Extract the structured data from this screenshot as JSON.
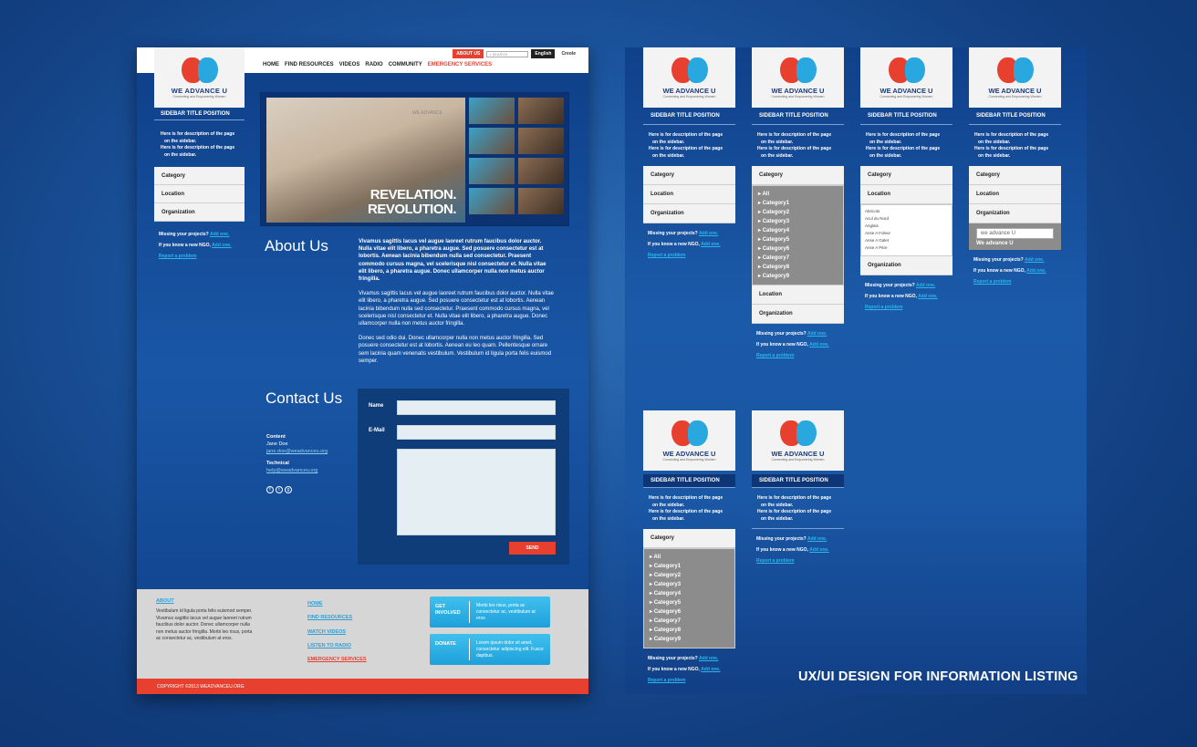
{
  "brand": {
    "name": "WE ADVANCE U",
    "tagline": "Connecting and Empowering Women"
  },
  "topbar": {
    "about": "ABOUT US",
    "search_placeholder": "SEARCH",
    "lang_en": "English",
    "lang_cr": "Creole"
  },
  "nav": [
    "HOME",
    "FIND RESOURCES",
    "VIDEOS",
    "RADIO",
    "COMMUNITY",
    "EMERGENCY SERVICES"
  ],
  "sidebar": {
    "title": "SIDEBAR TITLE POSITION",
    "desc1": "Here is for description of the page",
    "desc2": "on the sidebar.",
    "items": [
      "Category",
      "Location",
      "Organization"
    ],
    "missing": "Missing your projects?",
    "add": "Add one.",
    "know": "If you know a new NGO,",
    "report": "Report a problem"
  },
  "hero": {
    "line1": "REVELATION.",
    "line2": "REVOLUTION.",
    "mini": "WE ADVANCE"
  },
  "about": {
    "heading": "About Us",
    "p1": "Vivamus sagittis lacus vel augue laoreet rutrum faucibus dolor auctor. Nulla vitae elit libero, a pharetra augue. Sed posuere consectetur est at lobortis. Aenean lacinia bibendum nulla sed consectetur. Praesent commodo cursus magna, vel scelerisque nisl consectetur et. Nulla vitae elit libero, a pharetra augue. Donec ullamcorper nulla non metus auctor fringilla.",
    "p2": "Vivamus sagittis lacus vel augue laoreet rutrum faucibus dolor auctor. Nulla vitae elit libero, a pharetra augue. Sed posuere consectetur est at lobortis. Aenean lacinia bibendum nulla sed consectetur. Praesent commodo cursus magna, vel scelerisque nisl consectetur et. Nulla vitae elit libero, a pharetra augue. Donec ullamcorper nulla non metus auctor fringilla.",
    "p3": "Donec sed odio dui. Donec ullamcorper nulla non metus auctor fringilla. Sed posuere consectetur est at lobortis. Aenean eu leo quam. Pellentesque ornare sem lacinia quam venenatis vestibulum. Vestibulum id ligula porta felis euismod semper."
  },
  "contact": {
    "heading": "Contact Us",
    "content_label": "Content",
    "content_name": "Jane Doe",
    "content_email": "jane.doe@weadvanceu.org",
    "tech_label": "Technical",
    "tech_email": "help@weadvanceu.org",
    "name_label": "Name",
    "email_label": "E-Mail",
    "send": "SEND",
    "social": [
      "f",
      "t",
      "g"
    ]
  },
  "footer": {
    "about": "ABOUT",
    "about_text": "Vestibulum id ligula porta felis euismod semper. Vivamus sagittis lacus vel augue laoreet rutrum faucibus dolor auctor. Donec ullamcorper nulla non metus auctor fringilla. Morbi leo risus, porta ac consectetur ac, vestibulum at eros.",
    "links": [
      "HOME",
      "FIND RESOURCES",
      "WATCH VIDEOS",
      "LISTEN TO RADIO",
      "EMERGENCY SERVICES"
    ],
    "box1_key": "GET INVOLVED",
    "box1_val": "Morbi leo risus, porta ac consectetur ac, vestibulum at eros",
    "box2_key": "DONATE",
    "box2_val": "Lorem ipsum dolor sit amet, consectetur adipiscing elit. Fusce dapibus.",
    "copyright": "COPYRIGHT ©2013 WEADVANCEU.ORG"
  },
  "dropdown": {
    "cats": [
      "All",
      "Category1",
      "Category2",
      "Category3",
      "Category4",
      "Category5",
      "Category6",
      "Category7",
      "Category8",
      "Category9"
    ],
    "locations": [
      "Abricots",
      "Acul du Nord",
      "Anglais",
      "Anse A Foleur",
      "Anse A Galet",
      "Anse A Pitre"
    ],
    "search_value": "we advance U",
    "result": "We advance U"
  },
  "caption": "UX/UI DESIGN FOR INFORMATION LISTING",
  "colors": {
    "accent_red": "#e8402f",
    "accent_blue": "#29a8df",
    "navy": "#0f3f88"
  }
}
